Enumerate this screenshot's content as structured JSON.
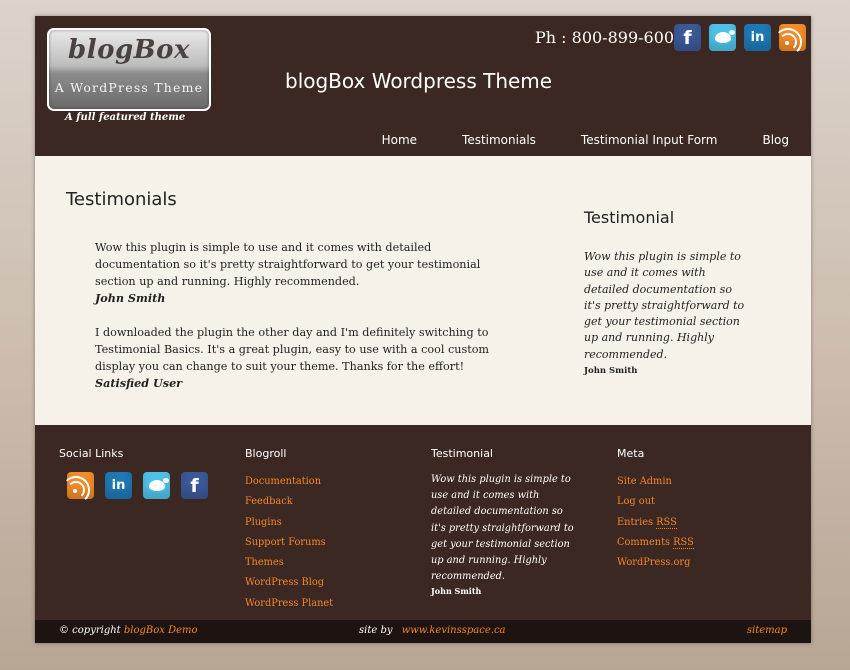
{
  "header": {
    "logo_title": "blogBox",
    "logo_subtitle": "A WordPress Theme",
    "tagline": "A full featured theme",
    "phone": "Ph : 800-899-6000",
    "site_title": "blogBox Wordpress Theme",
    "social_icons": [
      "facebook-icon",
      "twitter-icon",
      "linkedin-icon",
      "rss-icon"
    ]
  },
  "nav": {
    "items": [
      "Home",
      "Testimonials",
      "Testimonial Input Form",
      "Blog"
    ]
  },
  "main": {
    "heading": "Testimonials",
    "testimonials": [
      {
        "text": "Wow this plugin is simple to use and it comes with detailed documentation so it's pretty straightforward to get your testimonial section up and running. Highly recommended.",
        "author": "John Smith"
      },
      {
        "text": "I downloaded the plugin the other day and I'm definitely switching to Testimonial Basics. It's a great plugin, easy to use with a cool custom display you can change to suit your theme. Thanks for the effort!",
        "author": "Satisfied User"
      }
    ]
  },
  "sidebar": {
    "heading": "Testimonial",
    "text": "Wow this plugin is simple to use and it comes with detailed documentation so it's pretty straightforward to get your testimonial section up and running. Highly recommended.",
    "author": "John Smith"
  },
  "footer": {
    "social": {
      "heading": "Social Links",
      "icons": [
        "rss-icon",
        "linkedin-icon",
        "twitter-icon",
        "facebook-icon"
      ]
    },
    "blogroll": {
      "heading": "Blogroll",
      "links": [
        "Documentation",
        "Feedback",
        "Plugins",
        "Support Forums",
        "Themes",
        "WordPress Blog",
        "WordPress Planet"
      ]
    },
    "testimonial": {
      "heading": "Testimonial",
      "text": "Wow this plugin is simple to use and it comes with detailed documentation so it's pretty straightforward to get your testimonial section up and running. Highly recommended.",
      "author": "John Smith"
    },
    "meta": {
      "heading": "Meta",
      "links": [
        "Site Admin",
        "Log out",
        "Entries ",
        "Comments ",
        "WordPress.org"
      ],
      "rss_abbr": "RSS"
    }
  },
  "bottom": {
    "copyright_prefix": "© copyright",
    "copyright_link": "blogBox Demo",
    "site_by_prefix": "site by",
    "site_by_link": "www.kevinsspace.ca",
    "sitemap": "sitemap"
  },
  "colors": {
    "header_bg": "#3b2822",
    "content_bg": "#f6f1e9",
    "link_orange": "#f5862a",
    "bottom_bar": "#1d1412"
  }
}
